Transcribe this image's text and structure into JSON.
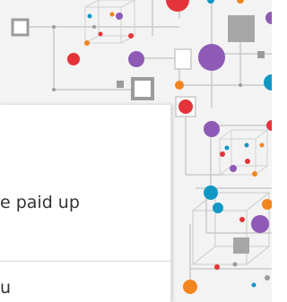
{
  "text_lines": {
    "line_1": "e paid up",
    "line_2": "u"
  },
  "colors": {
    "purple": "#8e5ab6",
    "orange": "#f1861f",
    "red": "#e5333a",
    "teal": "#1197c4",
    "gray": "#9b9b9b",
    "light_gray": "#d8d8d8",
    "line": "#c9c9c9"
  },
  "icons": [
    "cube-wireframe-icon",
    "node-network-icon"
  ]
}
